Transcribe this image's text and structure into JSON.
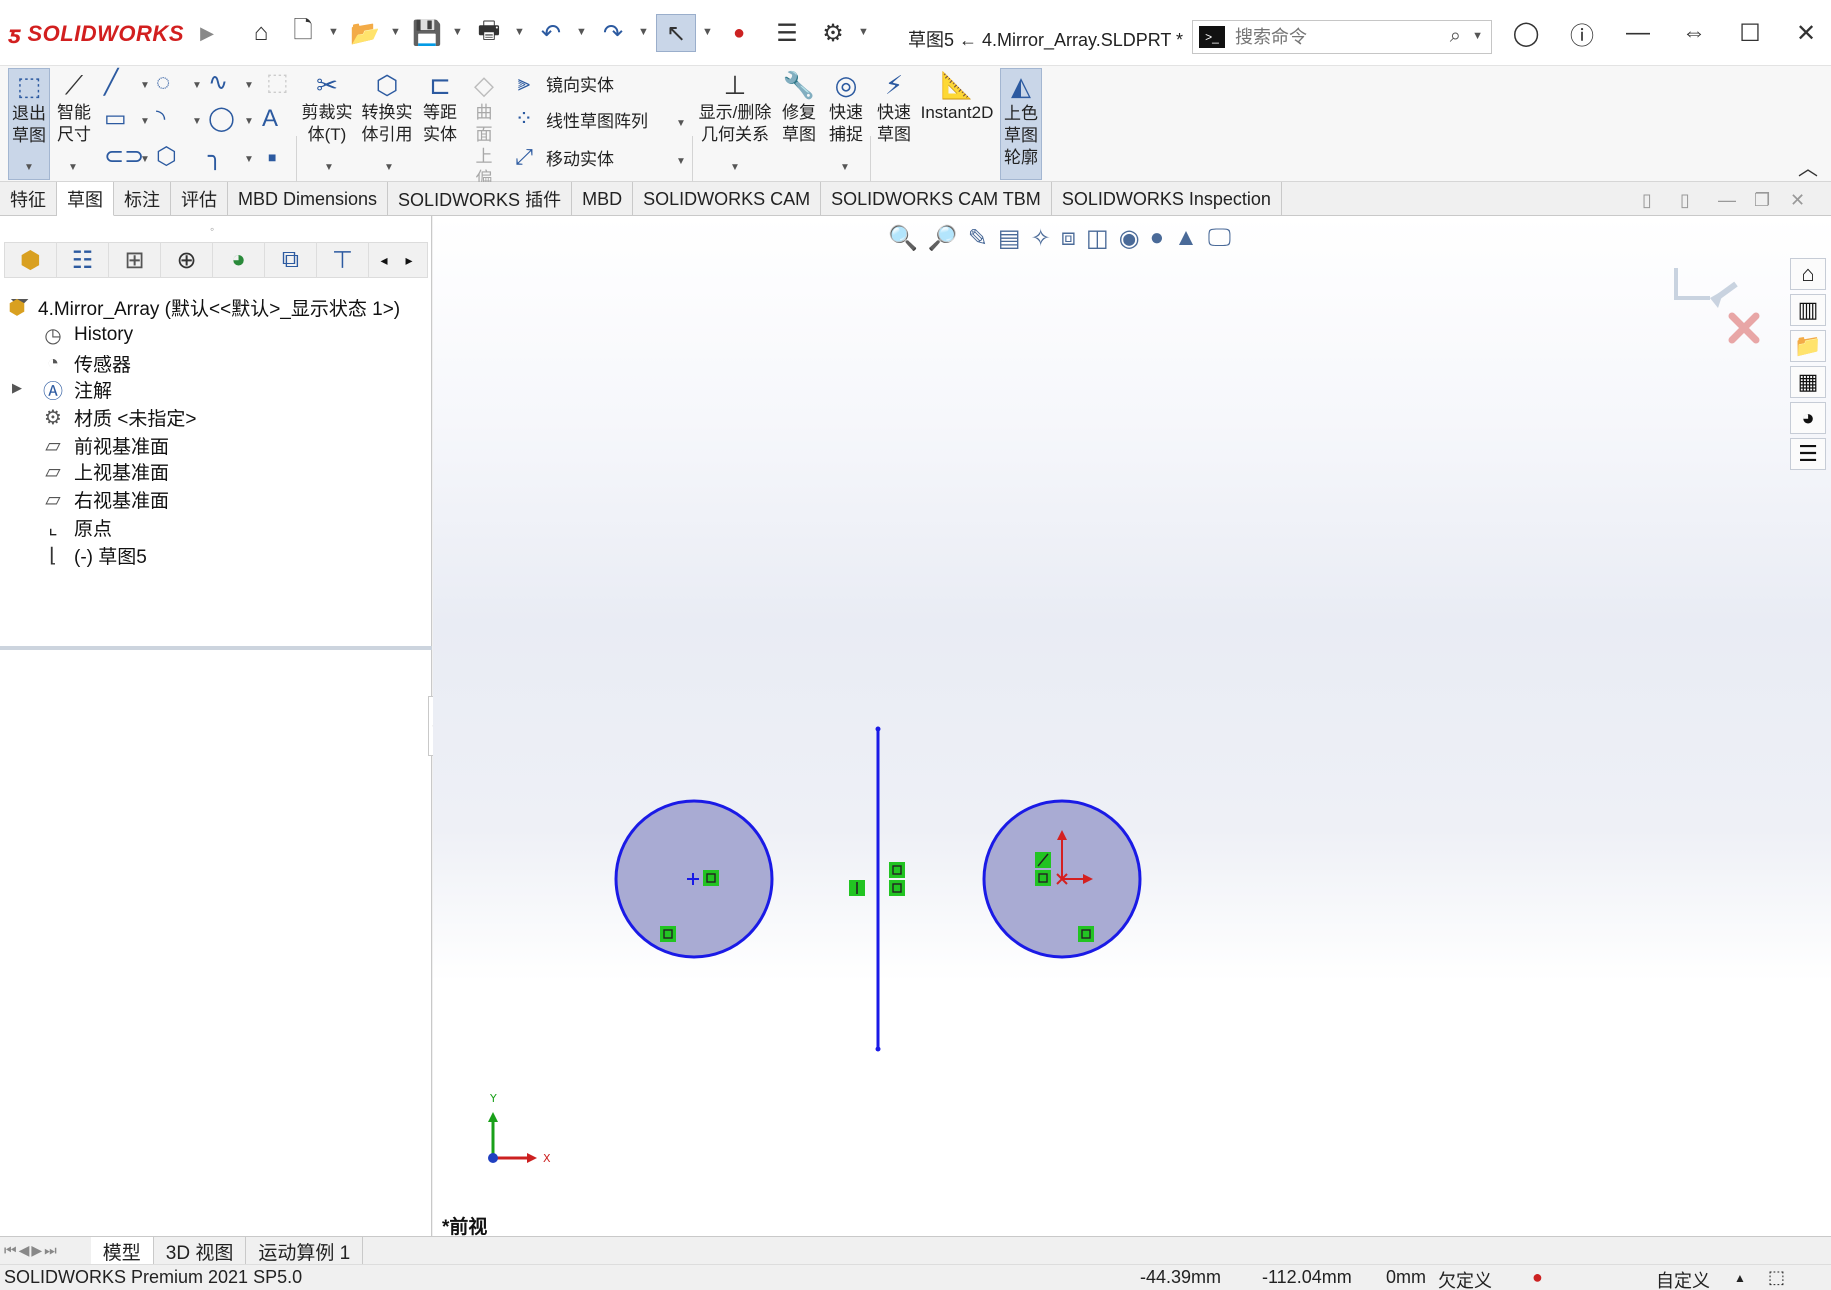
{
  "app": {
    "logo": "SOLIDWORKS",
    "title": "草图5 ← 4.Mirror_Array.SLDPRT *",
    "search_placeholder": "搜索命令"
  },
  "ribbon": {
    "exit_sketch": "退出草图",
    "smart_dim": "智能尺寸",
    "trim": "剪裁实体(T)",
    "convert": "转换实体引用",
    "offset": "等距实体",
    "surface_offset": "曲面上偏移",
    "mirror": "镜向实体",
    "linear_pattern": "线性草图阵列",
    "move": "移动实体",
    "display_relations": "显示/删除几何关系",
    "repair": "修复草图",
    "quick_snap": "快速捕捉",
    "rapid_sketch": "快速草图",
    "instant2d": "Instant2D",
    "shaded_contours": "上色草图轮廓"
  },
  "tabs": [
    "特征",
    "草图",
    "标注",
    "评估",
    "MBD Dimensions",
    "SOLIDWORKS 插件",
    "MBD",
    "SOLIDWORKS CAM",
    "SOLIDWORKS CAM TBM",
    "SOLIDWORKS Inspection"
  ],
  "tree": {
    "root": "4.Mirror_Array  (默认<<默认>_显示状态 1>)",
    "items": [
      "History",
      "传感器",
      "注解",
      "材质 <未指定>",
      "前视基准面",
      "上视基准面",
      "右视基准面",
      "原点",
      "(-) 草图5"
    ]
  },
  "viewport": {
    "view_name": "*前视",
    "axis_x": "X",
    "axis_y": "Y"
  },
  "bottom_tabs": [
    "模型",
    "3D 视图",
    "运动算例 1"
  ],
  "status": {
    "product": "SOLIDWORKS Premium 2021 SP5.0",
    "x": "-44.39mm",
    "y": "-112.04mm",
    "z": "0mm",
    "state": "欠定义",
    "units": "自定义"
  },
  "colors": {
    "sketch_line": "#1a1ae6",
    "circle_fill": "#a9abd3",
    "relation_marker": "#22c422",
    "origin": "#d42020"
  }
}
